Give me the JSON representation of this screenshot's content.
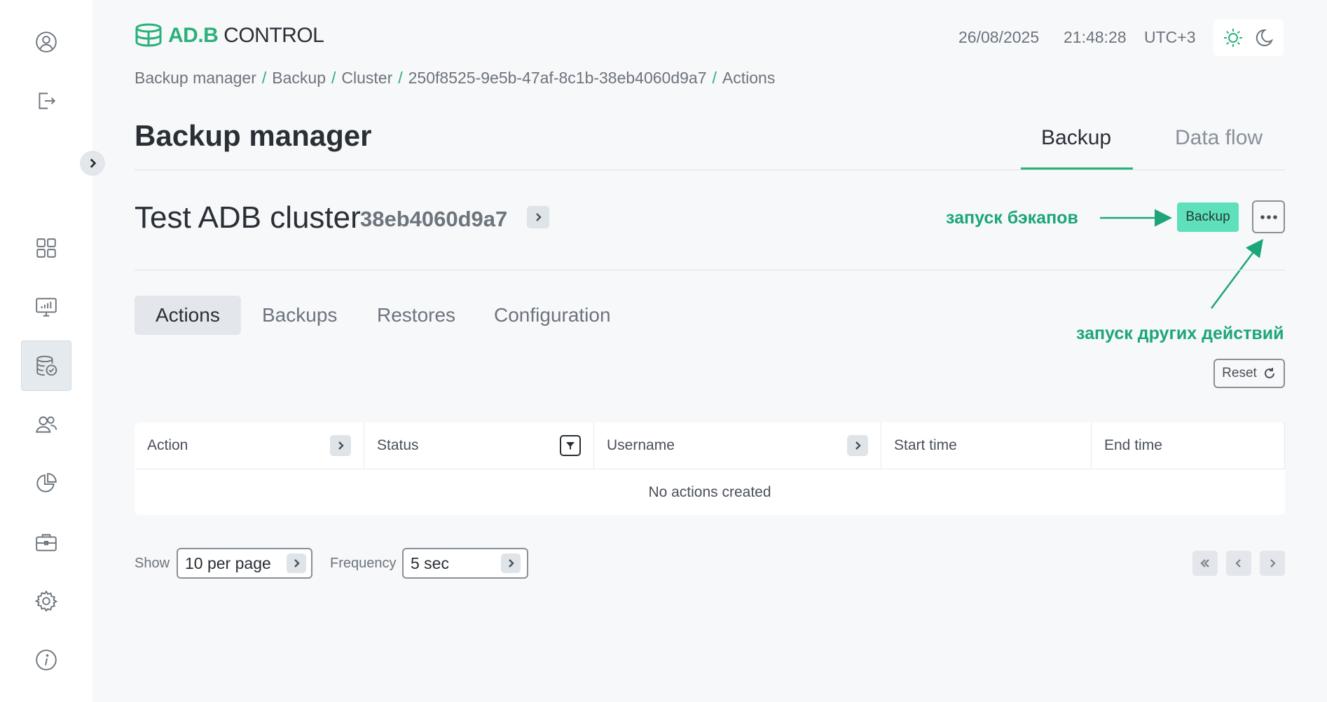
{
  "header": {
    "logo_text_adb": "AD.B",
    "logo_text_control": " CONTROL",
    "date": "26/08/2025",
    "time": "21:48:28",
    "timezone": "UTC+3"
  },
  "breadcrumb": [
    "Backup manager",
    "Backup",
    "Cluster",
    "250f8525-9e5b-47af-8c1b-38eb4060d9a7",
    "Actions"
  ],
  "page": {
    "title": "Backup manager",
    "tabs": [
      {
        "label": "Backup",
        "active": true
      },
      {
        "label": "Data flow",
        "active": false
      }
    ]
  },
  "cluster": {
    "name": "Test ADB cluster",
    "id": "38eb4060d9a7",
    "backup_button": "Backup"
  },
  "annotations": {
    "backup": "запуск бэкапов",
    "other": "запуск других действий"
  },
  "subtabs": [
    {
      "label": "Actions",
      "active": true
    },
    {
      "label": "Backups",
      "active": false
    },
    {
      "label": "Restores",
      "active": false
    },
    {
      "label": "Configuration",
      "active": false
    }
  ],
  "reset_label": "Reset",
  "table": {
    "columns": [
      "Action",
      "Status",
      "Username",
      "Start time",
      "End time"
    ],
    "empty_message": "No actions created"
  },
  "footer": {
    "show_label": "Show",
    "show_value": "10 per page",
    "frequency_label": "Frequency",
    "frequency_value": "5 sec"
  },
  "colors": {
    "accent": "#2bb07a",
    "backup_button": "#5fe0bc",
    "annotation": "#1da57a"
  },
  "icons": {
    "sidebar": [
      "user-icon",
      "logout-icon",
      "dashboard-icon",
      "monitor-chart-icon",
      "database-check-icon",
      "users-icon",
      "pie-chart-icon",
      "briefcase-icon",
      "settings-icon",
      "info-icon"
    ],
    "theme": [
      "sun-icon",
      "moon-icon"
    ]
  }
}
